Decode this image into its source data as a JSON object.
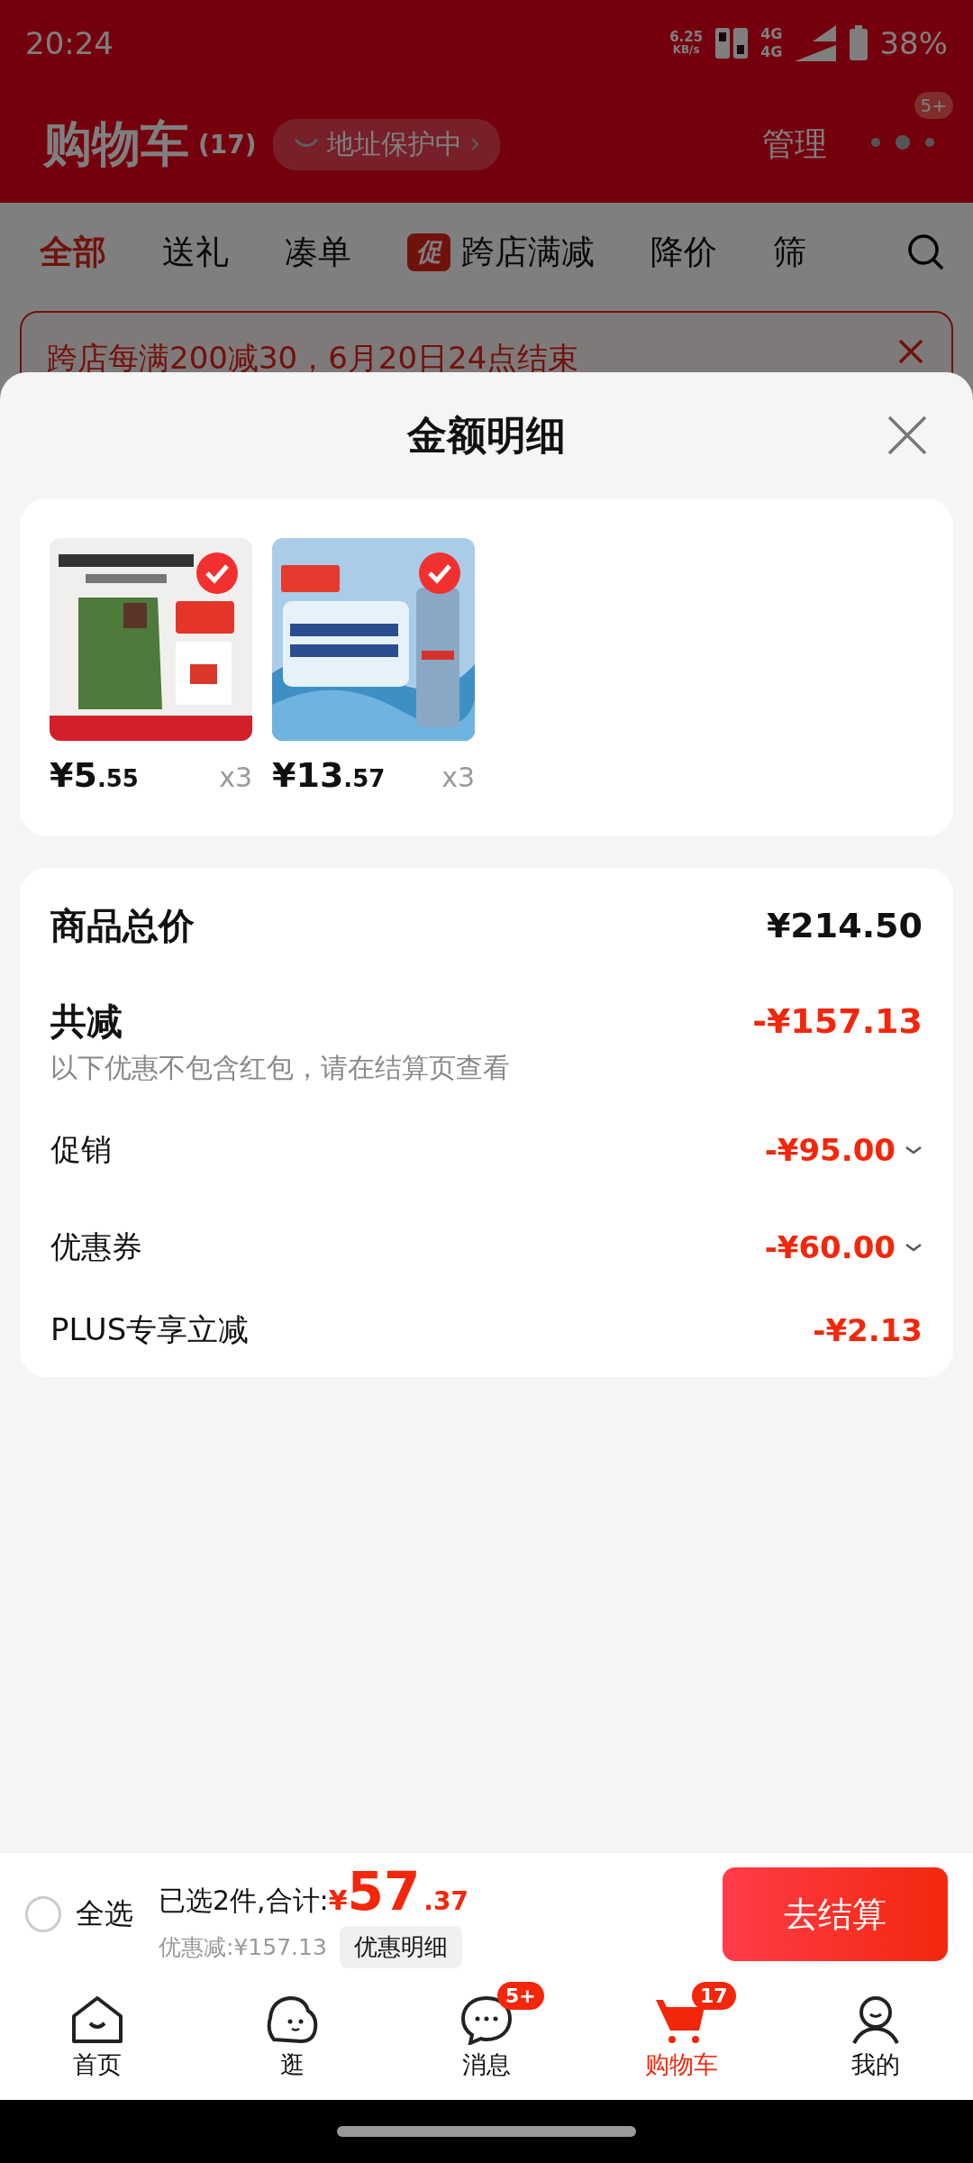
{
  "status_bar": {
    "time": "20:24",
    "speed": "6.25",
    "speed_unit": "KB/s",
    "network_1": "4G",
    "network_2": "4G",
    "battery": "38%"
  },
  "header": {
    "title": "购物车",
    "count": "(17)",
    "address_protection": "地址保护中",
    "manage": "管理",
    "more_badge": "5+"
  },
  "tabs": [
    {
      "label": "全部",
      "selected": true
    },
    {
      "label": "送礼",
      "selected": false
    },
    {
      "label": "凑单",
      "selected": false
    },
    {
      "label": "跨店满减",
      "tag": "促",
      "selected": false
    },
    {
      "label": "降价",
      "selected": false
    },
    {
      "label": "筛",
      "selected": false
    }
  ],
  "promo_banner": {
    "text": "跨店每满200减30，6月20日24点结束"
  },
  "sheet": {
    "title": "金额明细",
    "products": [
      {
        "kind": "picture",
        "selected": true,
        "price_yuan": "¥5",
        "price_fen": ".55",
        "quantity": "x3"
      },
      {
        "kind": "picture",
        "selected": true,
        "price_yuan": "¥13",
        "price_fen": ".57",
        "quantity": "x3"
      }
    ],
    "total": {
      "label": "商品总价",
      "value": "¥214.50"
    },
    "discount": {
      "label": "共减",
      "value": "-¥157.13",
      "note": "以下优惠不包含红包，请在结算页查看"
    },
    "discount_items": [
      {
        "label": "促销",
        "value": "-¥95.00",
        "expandable": true
      },
      {
        "label": "优惠券",
        "value": "-¥60.00",
        "expandable": true
      },
      {
        "label": "PLUS专享立减",
        "value": "-¥2.13",
        "expandable": false
      }
    ]
  },
  "checkout": {
    "select_all": {
      "label": "全选",
      "checked": false
    },
    "selected_text": "已选2件,合计:",
    "currency": "¥",
    "amount_main": "57",
    "amount_decimal": ".37",
    "discount_text": "优惠减:¥157.13",
    "detail_button": "优惠明细",
    "submit": "去结算"
  },
  "nav": [
    {
      "kind": "home",
      "label": "首页",
      "selected": false
    },
    {
      "kind": "browse",
      "label": "逛",
      "selected": false
    },
    {
      "kind": "messages",
      "label": "消息",
      "badge": "5+",
      "selected": false
    },
    {
      "kind": "cart",
      "label": "购物车",
      "badge": "17",
      "selected": true
    },
    {
      "kind": "profile",
      "label": "我的",
      "selected": false
    }
  ]
}
